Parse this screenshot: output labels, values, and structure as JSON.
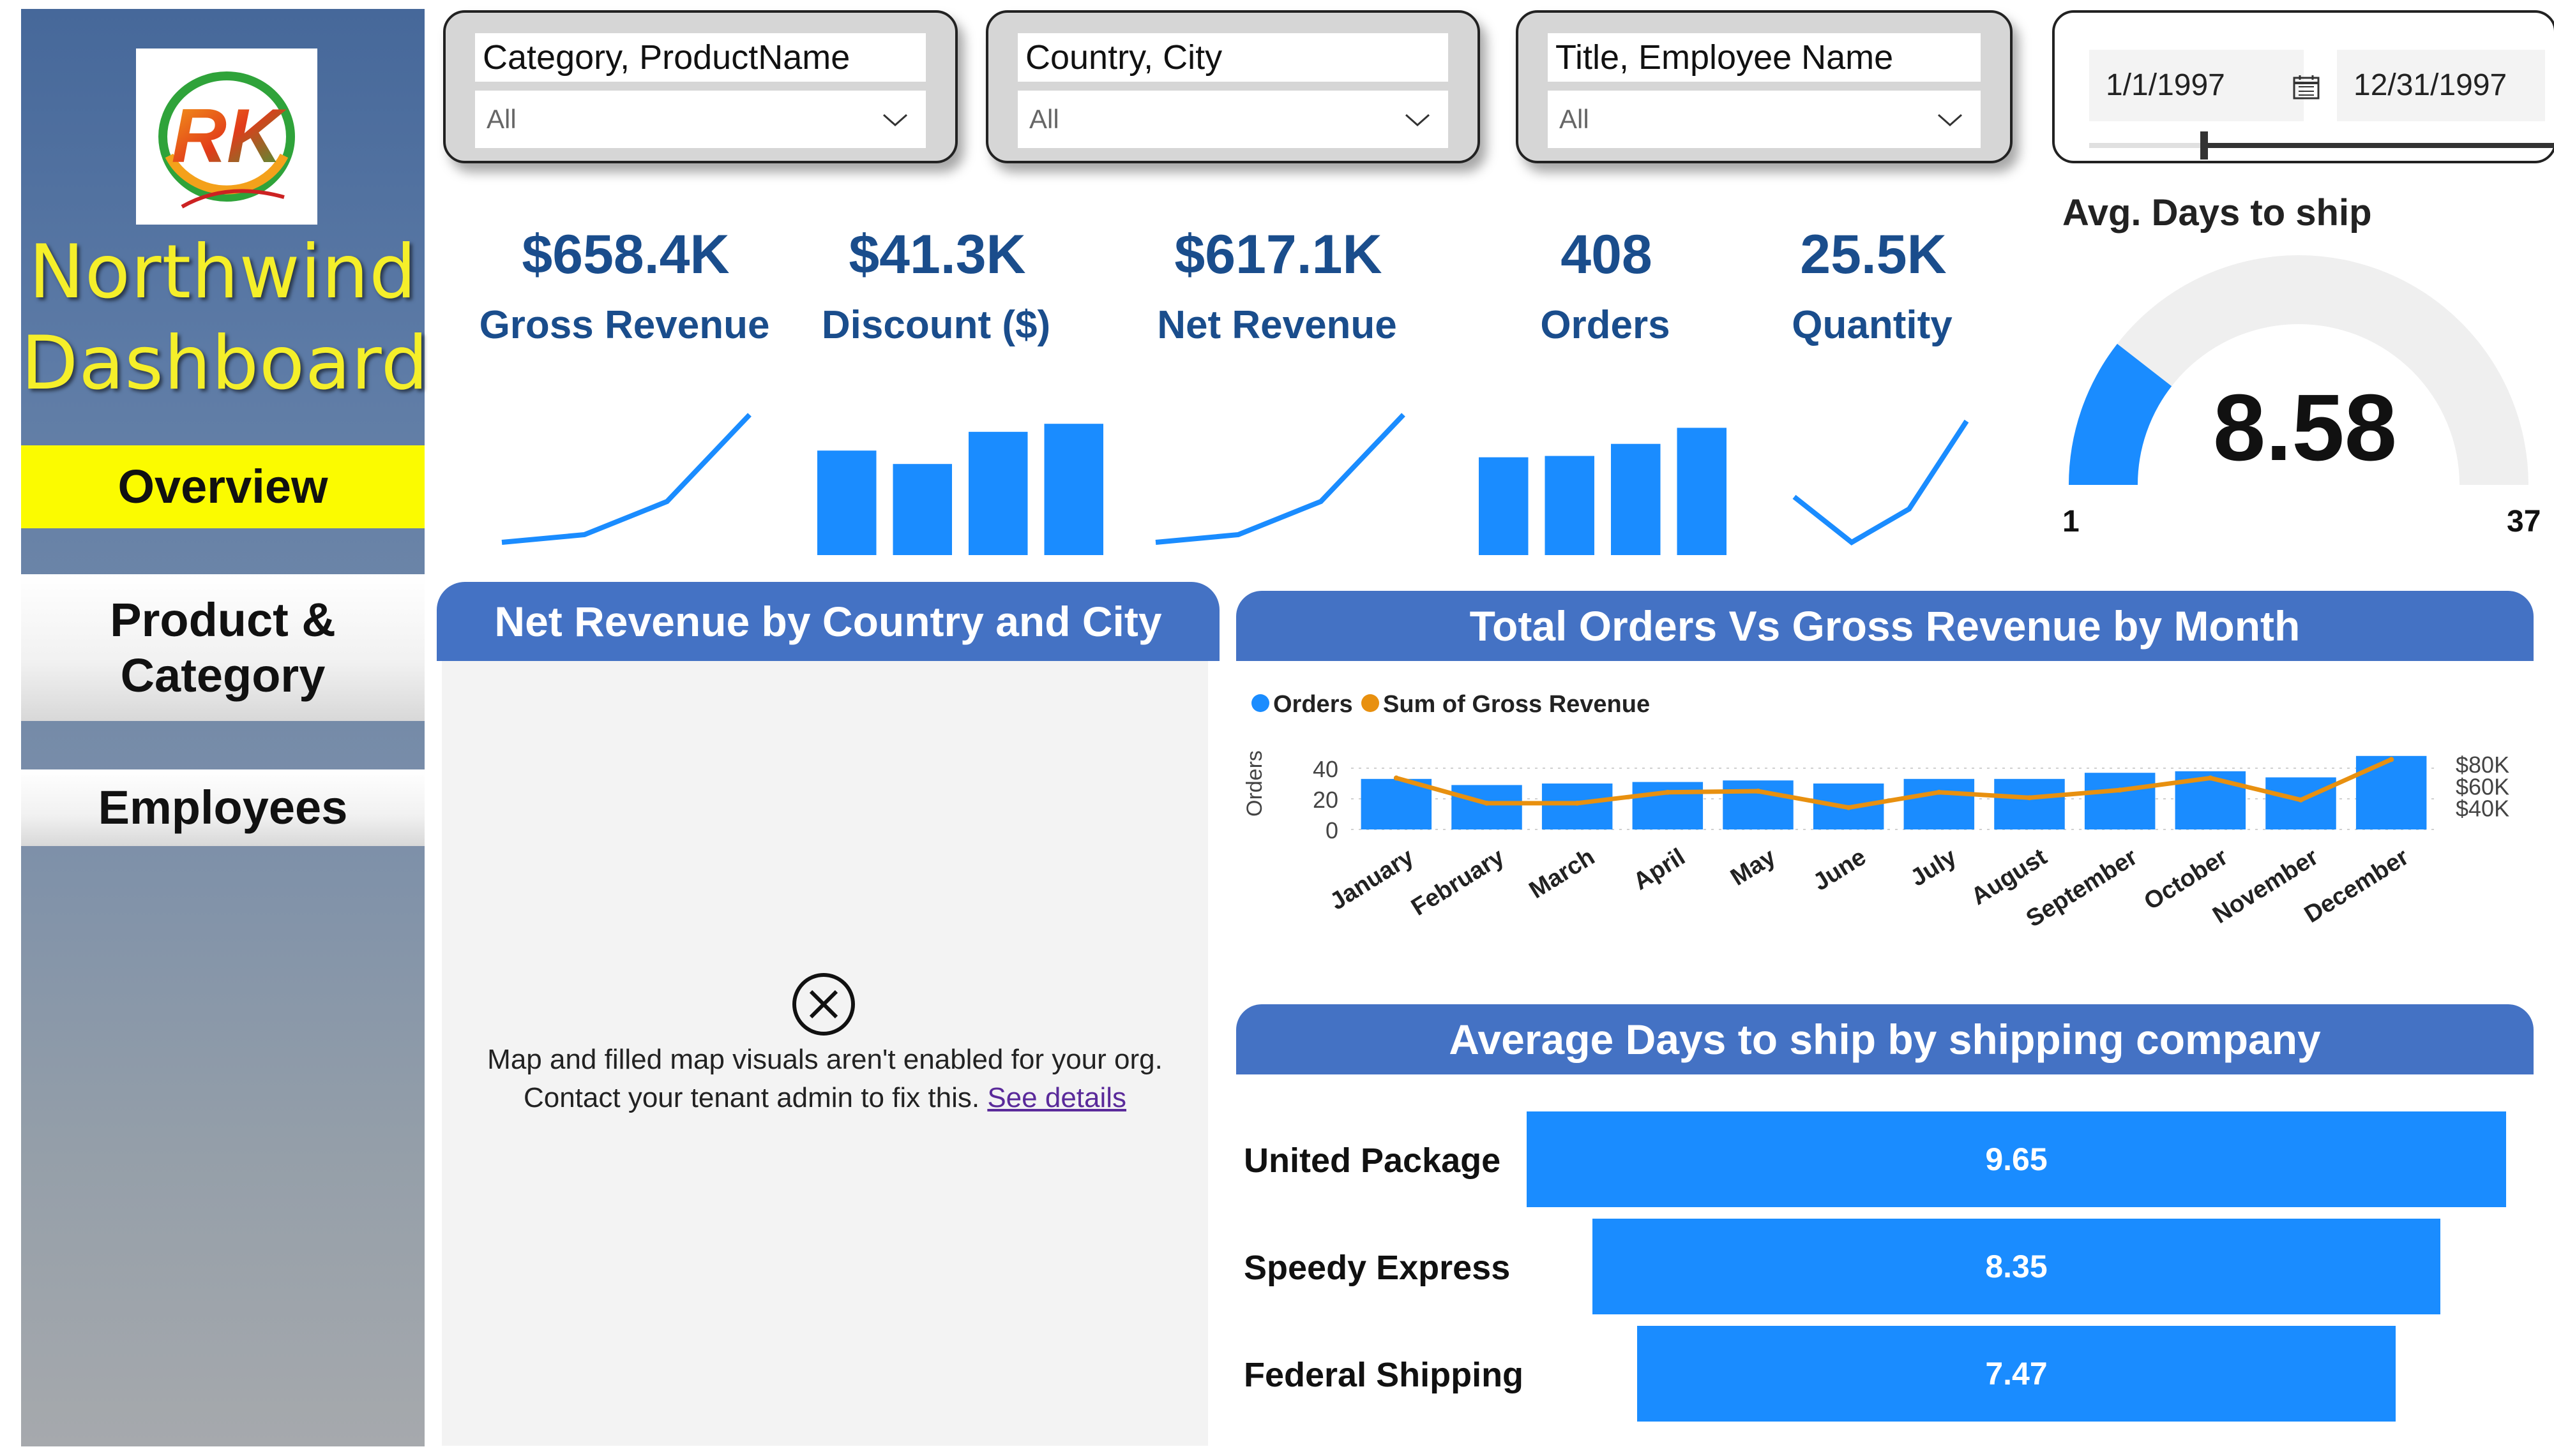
{
  "sidebar": {
    "brand_line1": "Northwind",
    "brand_line2": "Dashboard",
    "nav": [
      {
        "label": "Overview",
        "active": true
      },
      {
        "label": "Product & Category",
        "active": false
      },
      {
        "label": "Employees",
        "active": false
      }
    ]
  },
  "filters": {
    "category": {
      "title": "Category, ProductName",
      "value": "All"
    },
    "country": {
      "title": "Country, City",
      "value": "All"
    },
    "employee": {
      "title": "Title, Employee Name",
      "value": "All"
    },
    "date": {
      "start": "1/1/1997",
      "end": "12/31/1997"
    }
  },
  "kpis": [
    {
      "value": "$658.4K",
      "label": "Gross Revenue"
    },
    {
      "value": "$41.3K",
      "label": "Discount ($)"
    },
    {
      "value": "$617.1K",
      "label": "Net Revenue"
    },
    {
      "value": "408",
      "label": "Orders"
    },
    {
      "value": "25.5K",
      "label": "Quantity"
    }
  ],
  "gauge": {
    "title": "Avg. Days to ship",
    "value": "8.58",
    "min": "1",
    "max": "37"
  },
  "map_panel": {
    "title": "Net Revenue by Country and City",
    "message_line1": "Map and filled map visuals aren't enabled for your org.",
    "message_line2": "Contact your tenant admin to fix this.",
    "link_text": "See details"
  },
  "orders_panel": {
    "title": "Total Orders Vs Gross Revenue by Month"
  },
  "ship_panel": {
    "title": "Average Days to ship by shipping company"
  },
  "colors": {
    "accent": "#4472c4",
    "bar": "#1a8cff",
    "line": "#e8900f",
    "kpi_text": "#1a4d8c",
    "brand_yellow": "#f5ef2a",
    "nav_active": "#fbfb00"
  },
  "chart_data": [
    {
      "type": "bar",
      "title": "Total Orders Vs Gross Revenue by Month",
      "categories": [
        "January",
        "February",
        "March",
        "April",
        "May",
        "June",
        "July",
        "August",
        "September",
        "October",
        "November",
        "December"
      ],
      "series": [
        {
          "name": "Orders",
          "axis": "left",
          "type": "bar",
          "values": [
            33,
            29,
            30,
            31,
            32,
            30,
            33,
            33,
            37,
            38,
            34,
            48
          ]
        },
        {
          "name": "Sum of Gross Revenue",
          "axis": "right",
          "type": "line",
          "values": [
            67000,
            44000,
            44000,
            54000,
            55000,
            40000,
            54000,
            49000,
            56000,
            67000,
            47000,
            84000
          ]
        }
      ],
      "ylabel": "Orders",
      "yticks": [
        0,
        20,
        40
      ],
      "ylim": [
        0,
        50
      ],
      "y2ticks": [
        "$40K",
        "$60K",
        "$80K"
      ],
      "y2lim": [
        20000,
        90000
      ],
      "legend_position": "top-left",
      "grid": true
    },
    {
      "type": "bar",
      "orientation": "horizontal",
      "title": "Average Days to ship by shipping company",
      "categories": [
        "United Package",
        "Speedy Express",
        "Federal Shipping"
      ],
      "values": [
        9.65,
        8.35,
        7.47
      ]
    },
    {
      "type": "line",
      "kpi": "Gross Revenue",
      "values": [
        1,
        1.3,
        2.6,
        6.0
      ]
    },
    {
      "type": "bar",
      "kpi": "Discount ($)",
      "values": [
        0.78,
        0.68,
        0.92,
        0.98
      ]
    },
    {
      "type": "line",
      "kpi": "Net Revenue",
      "values": [
        1,
        1.3,
        2.6,
        6.0
      ]
    },
    {
      "type": "bar",
      "kpi": "Orders",
      "values": [
        0.73,
        0.74,
        0.83,
        0.95
      ]
    },
    {
      "type": "line",
      "kpi": "Quantity",
      "values": [
        4.0,
        1.0,
        3.2,
        9.0
      ]
    },
    {
      "type": "gauge",
      "value": 8.58,
      "min": 1,
      "max": 37
    }
  ]
}
